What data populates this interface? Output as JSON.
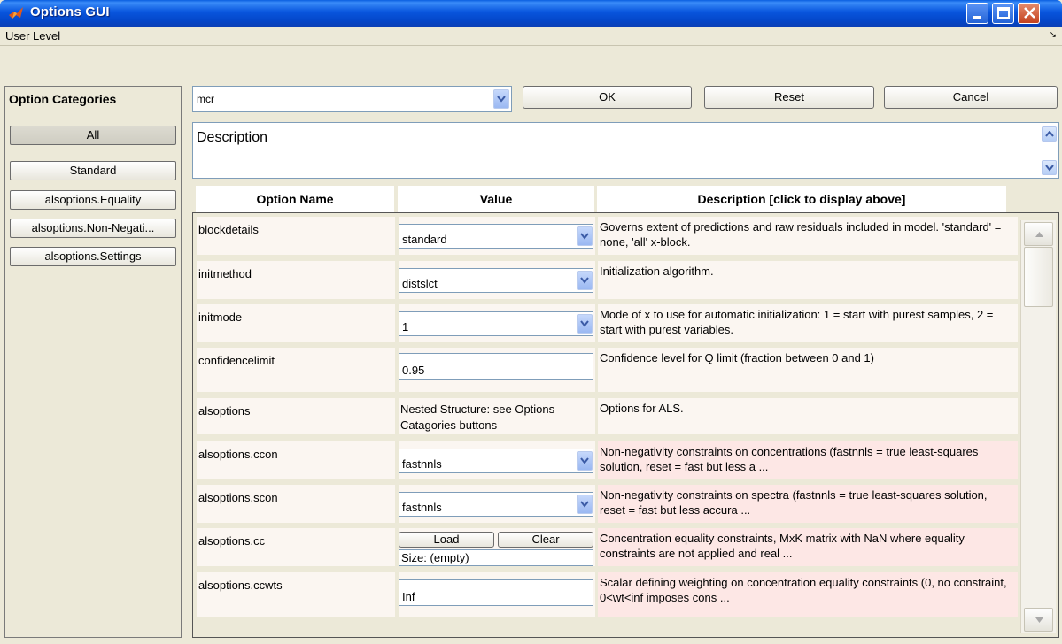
{
  "window": {
    "title": "Options GUI",
    "icon": "matlab-icon",
    "minimize_icon": "minimize-icon",
    "maximize_icon": "maximize-icon",
    "close_icon": "close-icon"
  },
  "menubar": {
    "user_level": "User Level",
    "corner_glyph": "↘"
  },
  "categories": {
    "header": "Option Categories",
    "buttons": [
      "All",
      "Standard",
      "alsoptions.Equality",
      "alsoptions.Non-Negati...",
      "alsoptions.Settings"
    ],
    "active": "All"
  },
  "toolbar": {
    "function_value": "mcr",
    "ok_label": "OK",
    "reset_label": "Reset",
    "cancel_label": "Cancel"
  },
  "description_box": {
    "label": "Description"
  },
  "table": {
    "columns": [
      "Option Name",
      "Value",
      "Description [click to display above]"
    ],
    "rows": [
      {
        "name": "blockdetails",
        "type": "select",
        "value": "standard",
        "description": "Governs extent of predictions and raw residuals included in model. 'standard' = none, 'all' x-block.",
        "highlight": false
      },
      {
        "name": "initmethod",
        "type": "select",
        "value": "distslct",
        "description": "Initialization algorithm.",
        "highlight": false
      },
      {
        "name": "initmode",
        "type": "select",
        "value": "1",
        "description": "Mode of x to use for automatic initialization: 1 = start with purest samples, 2 = start with purest variables.",
        "highlight": false
      },
      {
        "name": "confidencelimit",
        "type": "input",
        "value": "0.95",
        "description": "Confidence level for Q limit (fraction between 0 and 1)",
        "highlight": false
      },
      {
        "name": "alsoptions",
        "type": "text",
        "value": "Nested Structure: see Options Catagories buttons",
        "description": "Options for ALS.",
        "highlight": false
      },
      {
        "name": "alsoptions.ccon",
        "type": "select",
        "value": "fastnnls",
        "description": "Non-negativity constraints on concentrations (fastnnls = true least-squares solution, reset = fast but less a ...",
        "highlight": true
      },
      {
        "name": "alsoptions.scon",
        "type": "select",
        "value": "fastnnls",
        "description": "Non-negativity constraints on spectra (fastnnls = true least-squares solution, reset = fast but less accura ...",
        "highlight": true
      },
      {
        "name": "alsoptions.cc",
        "type": "loadclear",
        "value": "Size: (empty)",
        "load_label": "Load",
        "clear_label": "Clear",
        "description": "Concentration equality constraints, MxK matrix with NaN where equality constraints are not applied and real  ...",
        "highlight": true
      },
      {
        "name": "alsoptions.ccwts",
        "type": "input",
        "value": "Inf",
        "description": "Scalar defining weighting on concentration equality constraints (0, no constraint, 0<wt<inf imposes cons ...",
        "highlight": true
      }
    ]
  },
  "colors": {
    "titlebar": "#0855dd",
    "row_bg": "#fbf6f1",
    "row_highlight": "#fde7e5",
    "window_bg": "#ece9d8"
  }
}
